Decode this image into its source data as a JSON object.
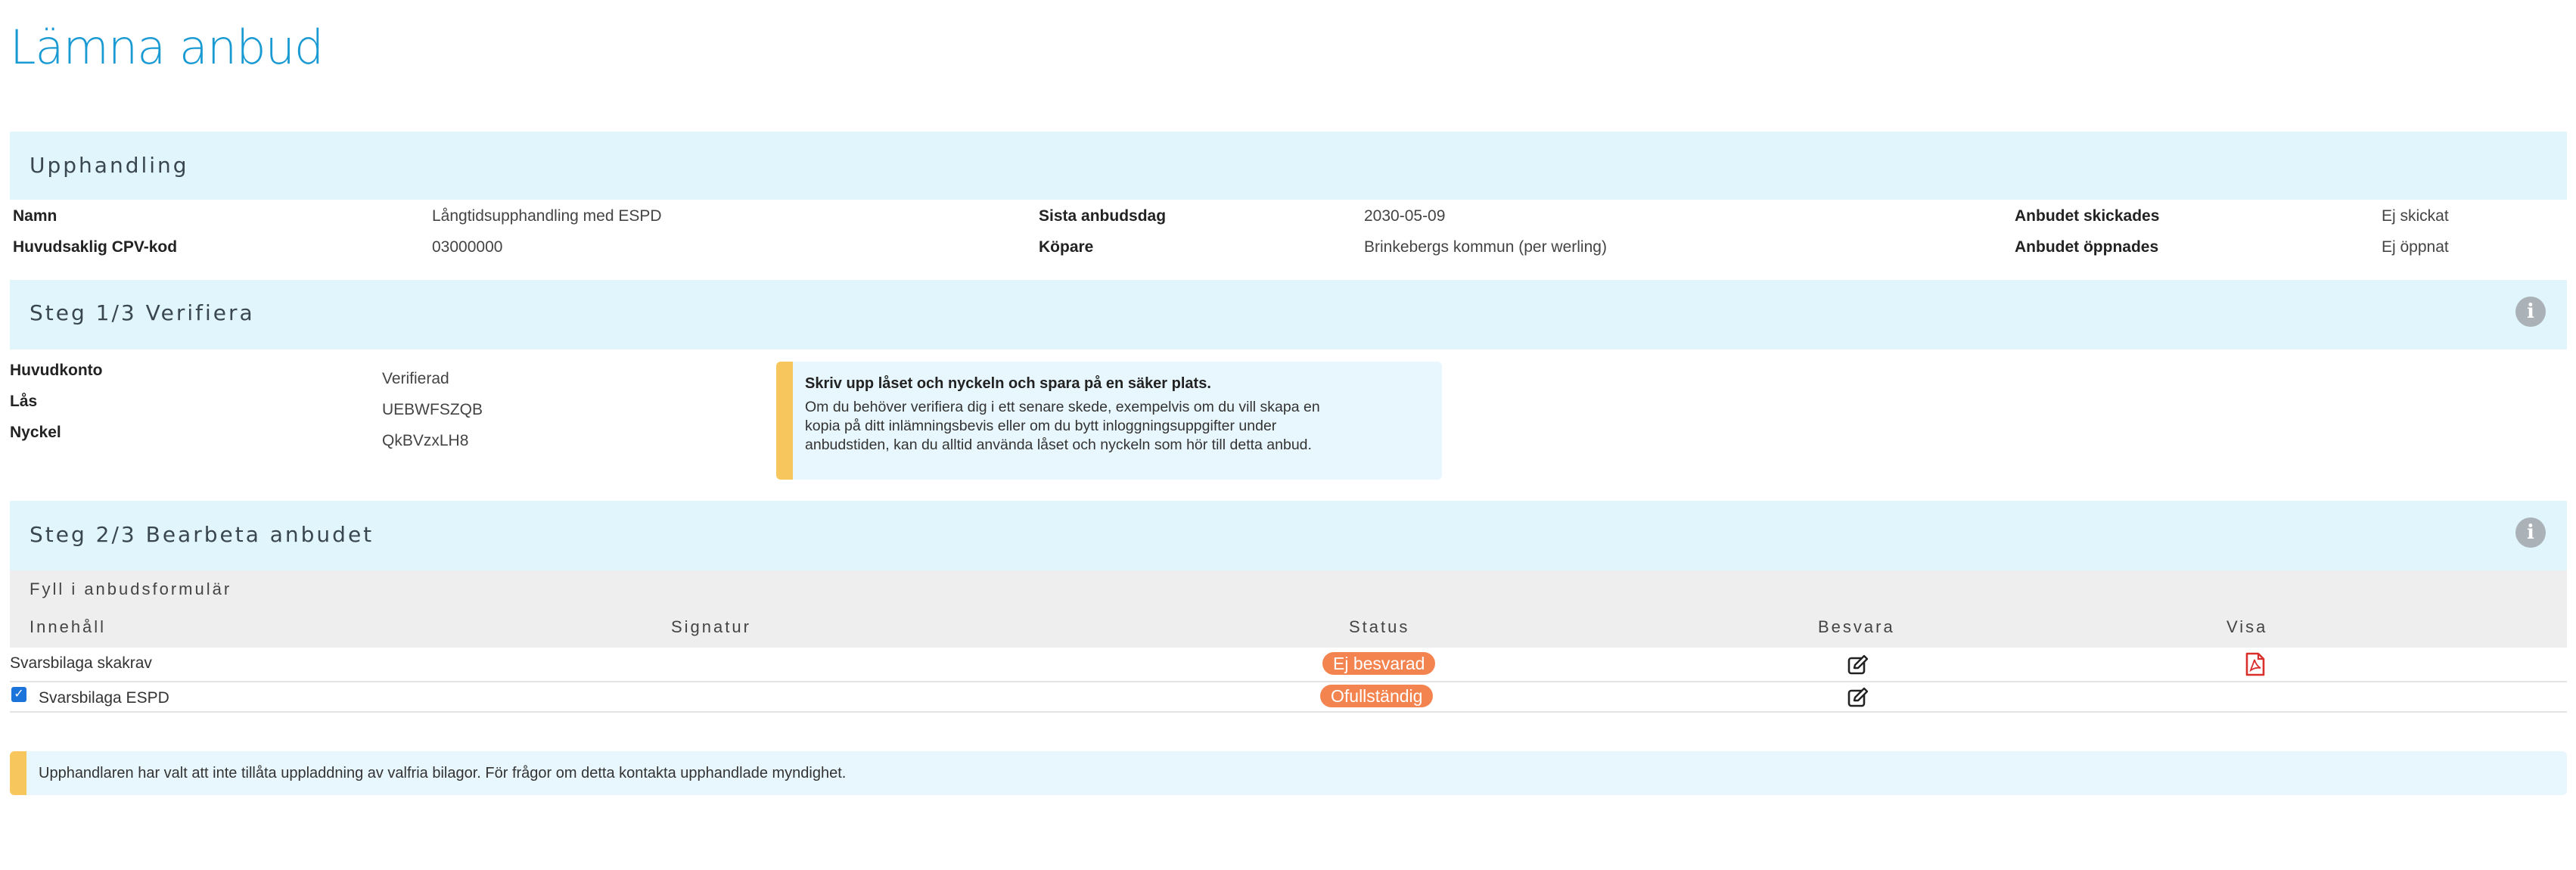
{
  "page": {
    "title": "Lämna anbud"
  },
  "upphandling": {
    "title": "Upphandling",
    "fields": {
      "namn_label": "Namn",
      "namn_value": "Långtidsupphandling med ESPD",
      "cpv_label": "Huvudsaklig CPV-kod",
      "cpv_value": "03000000",
      "sista_label": "Sista anbudsdag",
      "sista_value": "2030-05-09",
      "kopare_label": "Köpare",
      "kopare_value": "Brinkebergs kommun (per werling)",
      "skickades_label": "Anbudet skickades",
      "skickades_value": "Ej skickat",
      "oppnades_label": "Anbudet öppnades",
      "oppnades_value": "Ej öppnat"
    }
  },
  "steg1": {
    "title": "Steg 1/3 Verifiera",
    "huvudkonto_label": "Huvudkonto",
    "huvudkonto_value": "Verifierad",
    "las_label": "Lås",
    "las_value": "UEBWFSZQB",
    "nyckel_label": "Nyckel",
    "nyckel_value": "QkBVzxLH8",
    "note": {
      "title": "Skriv upp låset och nyckeln och spara på en säker plats.",
      "lines": [
        "Om du behöver verifiera dig i ett senare skede, exempelvis om du vill skapa en",
        "kopia på ditt inlämningsbevis eller om du bytt inloggningsuppgifter under",
        "anbudstiden, kan du alltid använda låset och nyckeln som hör till detta anbud."
      ]
    }
  },
  "steg2": {
    "title": "Steg 2/3 Bearbeta anbudet",
    "subtitle": "Fyll i anbudsformulär",
    "columns": {
      "innehall": "Innehåll",
      "signatur": "Signatur",
      "status": "Status",
      "besvara": "Besvara",
      "visa": "Visa"
    },
    "rows": [
      {
        "name": "Svarsbilaga skakrav",
        "status": "Ej besvarad"
      },
      {
        "name": "Svarsbilaga ESPD",
        "status": "Ofullständig"
      }
    ],
    "bottom_note": "Upphandlaren har valt att inte tillåta uppladdning av valfria bilagor. För frågor om detta kontakta upphandlade myndighet."
  },
  "icons": {
    "info": "info-icon",
    "edit": "edit-icon",
    "pdf": "pdf-icon",
    "checkbox": "checkbox-checked-icon"
  },
  "colors": {
    "title_blue": "#1a9ad2",
    "band_bg": "#e0f5fc",
    "note_accent": "#f7c65d",
    "badge_orange": "#f4844f",
    "pdf_red": "#d9302c"
  }
}
